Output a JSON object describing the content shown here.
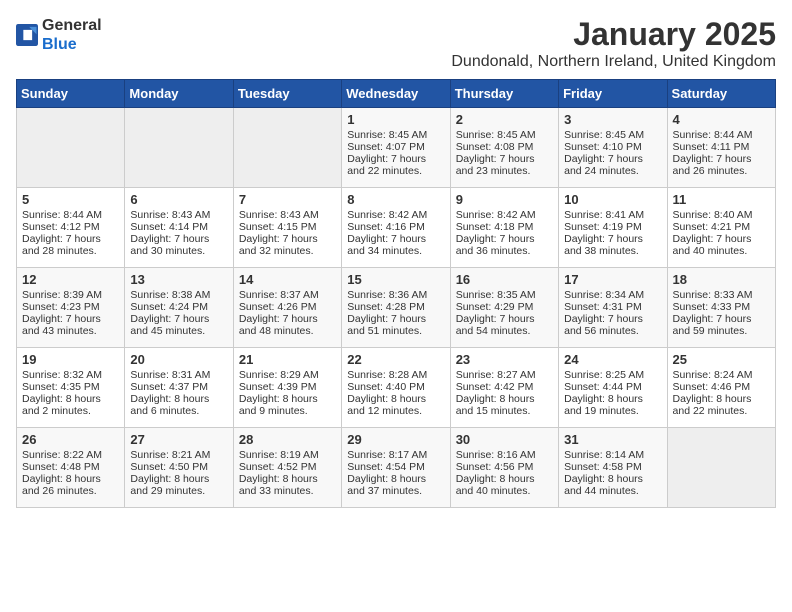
{
  "header": {
    "logo_general": "General",
    "logo_blue": "Blue",
    "title": "January 2025",
    "location": "Dundonald, Northern Ireland, United Kingdom"
  },
  "days_of_week": [
    "Sunday",
    "Monday",
    "Tuesday",
    "Wednesday",
    "Thursday",
    "Friday",
    "Saturday"
  ],
  "weeks": [
    {
      "days": [
        {
          "num": "",
          "empty": true
        },
        {
          "num": "",
          "empty": true
        },
        {
          "num": "",
          "empty": true
        },
        {
          "num": "1",
          "sunrise": "Sunrise: 8:45 AM",
          "sunset": "Sunset: 4:07 PM",
          "daylight": "Daylight: 7 hours and 22 minutes."
        },
        {
          "num": "2",
          "sunrise": "Sunrise: 8:45 AM",
          "sunset": "Sunset: 4:08 PM",
          "daylight": "Daylight: 7 hours and 23 minutes."
        },
        {
          "num": "3",
          "sunrise": "Sunrise: 8:45 AM",
          "sunset": "Sunset: 4:10 PM",
          "daylight": "Daylight: 7 hours and 24 minutes."
        },
        {
          "num": "4",
          "sunrise": "Sunrise: 8:44 AM",
          "sunset": "Sunset: 4:11 PM",
          "daylight": "Daylight: 7 hours and 26 minutes."
        }
      ]
    },
    {
      "days": [
        {
          "num": "5",
          "sunrise": "Sunrise: 8:44 AM",
          "sunset": "Sunset: 4:12 PM",
          "daylight": "Daylight: 7 hours and 28 minutes."
        },
        {
          "num": "6",
          "sunrise": "Sunrise: 8:43 AM",
          "sunset": "Sunset: 4:14 PM",
          "daylight": "Daylight: 7 hours and 30 minutes."
        },
        {
          "num": "7",
          "sunrise": "Sunrise: 8:43 AM",
          "sunset": "Sunset: 4:15 PM",
          "daylight": "Daylight: 7 hours and 32 minutes."
        },
        {
          "num": "8",
          "sunrise": "Sunrise: 8:42 AM",
          "sunset": "Sunset: 4:16 PM",
          "daylight": "Daylight: 7 hours and 34 minutes."
        },
        {
          "num": "9",
          "sunrise": "Sunrise: 8:42 AM",
          "sunset": "Sunset: 4:18 PM",
          "daylight": "Daylight: 7 hours and 36 minutes."
        },
        {
          "num": "10",
          "sunrise": "Sunrise: 8:41 AM",
          "sunset": "Sunset: 4:19 PM",
          "daylight": "Daylight: 7 hours and 38 minutes."
        },
        {
          "num": "11",
          "sunrise": "Sunrise: 8:40 AM",
          "sunset": "Sunset: 4:21 PM",
          "daylight": "Daylight: 7 hours and 40 minutes."
        }
      ]
    },
    {
      "days": [
        {
          "num": "12",
          "sunrise": "Sunrise: 8:39 AM",
          "sunset": "Sunset: 4:23 PM",
          "daylight": "Daylight: 7 hours and 43 minutes."
        },
        {
          "num": "13",
          "sunrise": "Sunrise: 8:38 AM",
          "sunset": "Sunset: 4:24 PM",
          "daylight": "Daylight: 7 hours and 45 minutes."
        },
        {
          "num": "14",
          "sunrise": "Sunrise: 8:37 AM",
          "sunset": "Sunset: 4:26 PM",
          "daylight": "Daylight: 7 hours and 48 minutes."
        },
        {
          "num": "15",
          "sunrise": "Sunrise: 8:36 AM",
          "sunset": "Sunset: 4:28 PM",
          "daylight": "Daylight: 7 hours and 51 minutes."
        },
        {
          "num": "16",
          "sunrise": "Sunrise: 8:35 AM",
          "sunset": "Sunset: 4:29 PM",
          "daylight": "Daylight: 7 hours and 54 minutes."
        },
        {
          "num": "17",
          "sunrise": "Sunrise: 8:34 AM",
          "sunset": "Sunset: 4:31 PM",
          "daylight": "Daylight: 7 hours and 56 minutes."
        },
        {
          "num": "18",
          "sunrise": "Sunrise: 8:33 AM",
          "sunset": "Sunset: 4:33 PM",
          "daylight": "Daylight: 7 hours and 59 minutes."
        }
      ]
    },
    {
      "days": [
        {
          "num": "19",
          "sunrise": "Sunrise: 8:32 AM",
          "sunset": "Sunset: 4:35 PM",
          "daylight": "Daylight: 8 hours and 2 minutes."
        },
        {
          "num": "20",
          "sunrise": "Sunrise: 8:31 AM",
          "sunset": "Sunset: 4:37 PM",
          "daylight": "Daylight: 8 hours and 6 minutes."
        },
        {
          "num": "21",
          "sunrise": "Sunrise: 8:29 AM",
          "sunset": "Sunset: 4:39 PM",
          "daylight": "Daylight: 8 hours and 9 minutes."
        },
        {
          "num": "22",
          "sunrise": "Sunrise: 8:28 AM",
          "sunset": "Sunset: 4:40 PM",
          "daylight": "Daylight: 8 hours and 12 minutes."
        },
        {
          "num": "23",
          "sunrise": "Sunrise: 8:27 AM",
          "sunset": "Sunset: 4:42 PM",
          "daylight": "Daylight: 8 hours and 15 minutes."
        },
        {
          "num": "24",
          "sunrise": "Sunrise: 8:25 AM",
          "sunset": "Sunset: 4:44 PM",
          "daylight": "Daylight: 8 hours and 19 minutes."
        },
        {
          "num": "25",
          "sunrise": "Sunrise: 8:24 AM",
          "sunset": "Sunset: 4:46 PM",
          "daylight": "Daylight: 8 hours and 22 minutes."
        }
      ]
    },
    {
      "days": [
        {
          "num": "26",
          "sunrise": "Sunrise: 8:22 AM",
          "sunset": "Sunset: 4:48 PM",
          "daylight": "Daylight: 8 hours and 26 minutes."
        },
        {
          "num": "27",
          "sunrise": "Sunrise: 8:21 AM",
          "sunset": "Sunset: 4:50 PM",
          "daylight": "Daylight: 8 hours and 29 minutes."
        },
        {
          "num": "28",
          "sunrise": "Sunrise: 8:19 AM",
          "sunset": "Sunset: 4:52 PM",
          "daylight": "Daylight: 8 hours and 33 minutes."
        },
        {
          "num": "29",
          "sunrise": "Sunrise: 8:17 AM",
          "sunset": "Sunset: 4:54 PM",
          "daylight": "Daylight: 8 hours and 37 minutes."
        },
        {
          "num": "30",
          "sunrise": "Sunrise: 8:16 AM",
          "sunset": "Sunset: 4:56 PM",
          "daylight": "Daylight: 8 hours and 40 minutes."
        },
        {
          "num": "31",
          "sunrise": "Sunrise: 8:14 AM",
          "sunset": "Sunset: 4:58 PM",
          "daylight": "Daylight: 8 hours and 44 minutes."
        },
        {
          "num": "",
          "empty": true
        }
      ]
    }
  ]
}
